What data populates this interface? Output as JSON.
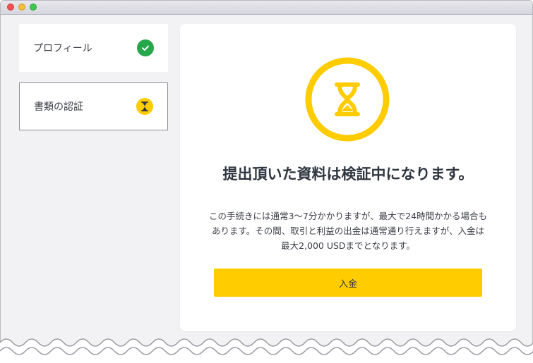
{
  "sidebar": {
    "steps": [
      {
        "label": "プロフィール",
        "status": "complete",
        "icon": "checkmark-icon",
        "status_color": "#26a74b"
      },
      {
        "label": "書類の認証",
        "status": "pending",
        "icon": "hourglass-icon",
        "status_color": "#ffcc00"
      }
    ]
  },
  "main": {
    "status_icon": "hourglass-icon",
    "title": "提出頂いた資料は検証中になります。",
    "description": "この手続きには通常3〜7分かかりますが、最大で24時間かかる場合もあります。その間、取引と利益の出金は通常通り行えますが、入金は最大2,000 USDまでとなります。",
    "deposit_button_label": "入金",
    "accent_color": "#ffcc00"
  }
}
